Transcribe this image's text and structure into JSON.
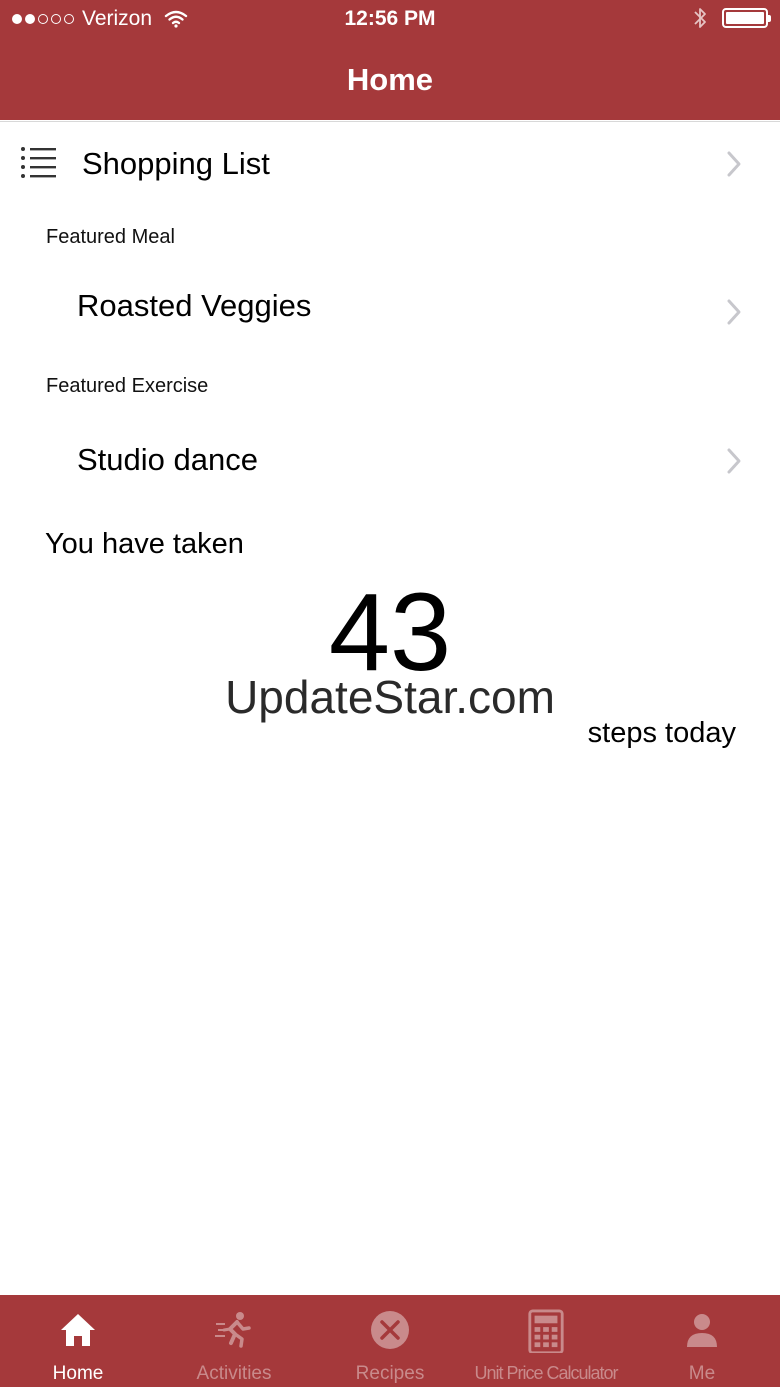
{
  "status_bar": {
    "carrier": "Verizon",
    "time": "12:56 PM",
    "signal_full": 2,
    "signal_total": 5,
    "battery_level": 1.0
  },
  "nav": {
    "title": "Home"
  },
  "shopping_list": {
    "label": "Shopping List",
    "icon": "list-icon"
  },
  "featured_meal": {
    "section_label": "Featured Meal",
    "item": "Roasted Veggies"
  },
  "featured_exercise": {
    "section_label": "Featured Exercise",
    "item": "Studio dance"
  },
  "steps": {
    "intro": "You have taken",
    "count": "43",
    "suffix": "steps today"
  },
  "watermark": "UpdateStar.com",
  "tabs": [
    {
      "label": "Home",
      "icon": "home-icon",
      "active": true
    },
    {
      "label": "Activities",
      "icon": "runner-icon",
      "active": false
    },
    {
      "label": "Recipes",
      "icon": "utensils-icon",
      "active": false
    },
    {
      "label": "Unit Price Calculator",
      "icon": "calculator-icon",
      "active": false
    },
    {
      "label": "Me",
      "icon": "person-icon",
      "active": false
    }
  ],
  "colors": {
    "brand": "#a5393b",
    "tab_inactive": "#c98a8b",
    "tab_active": "#ffffff"
  }
}
